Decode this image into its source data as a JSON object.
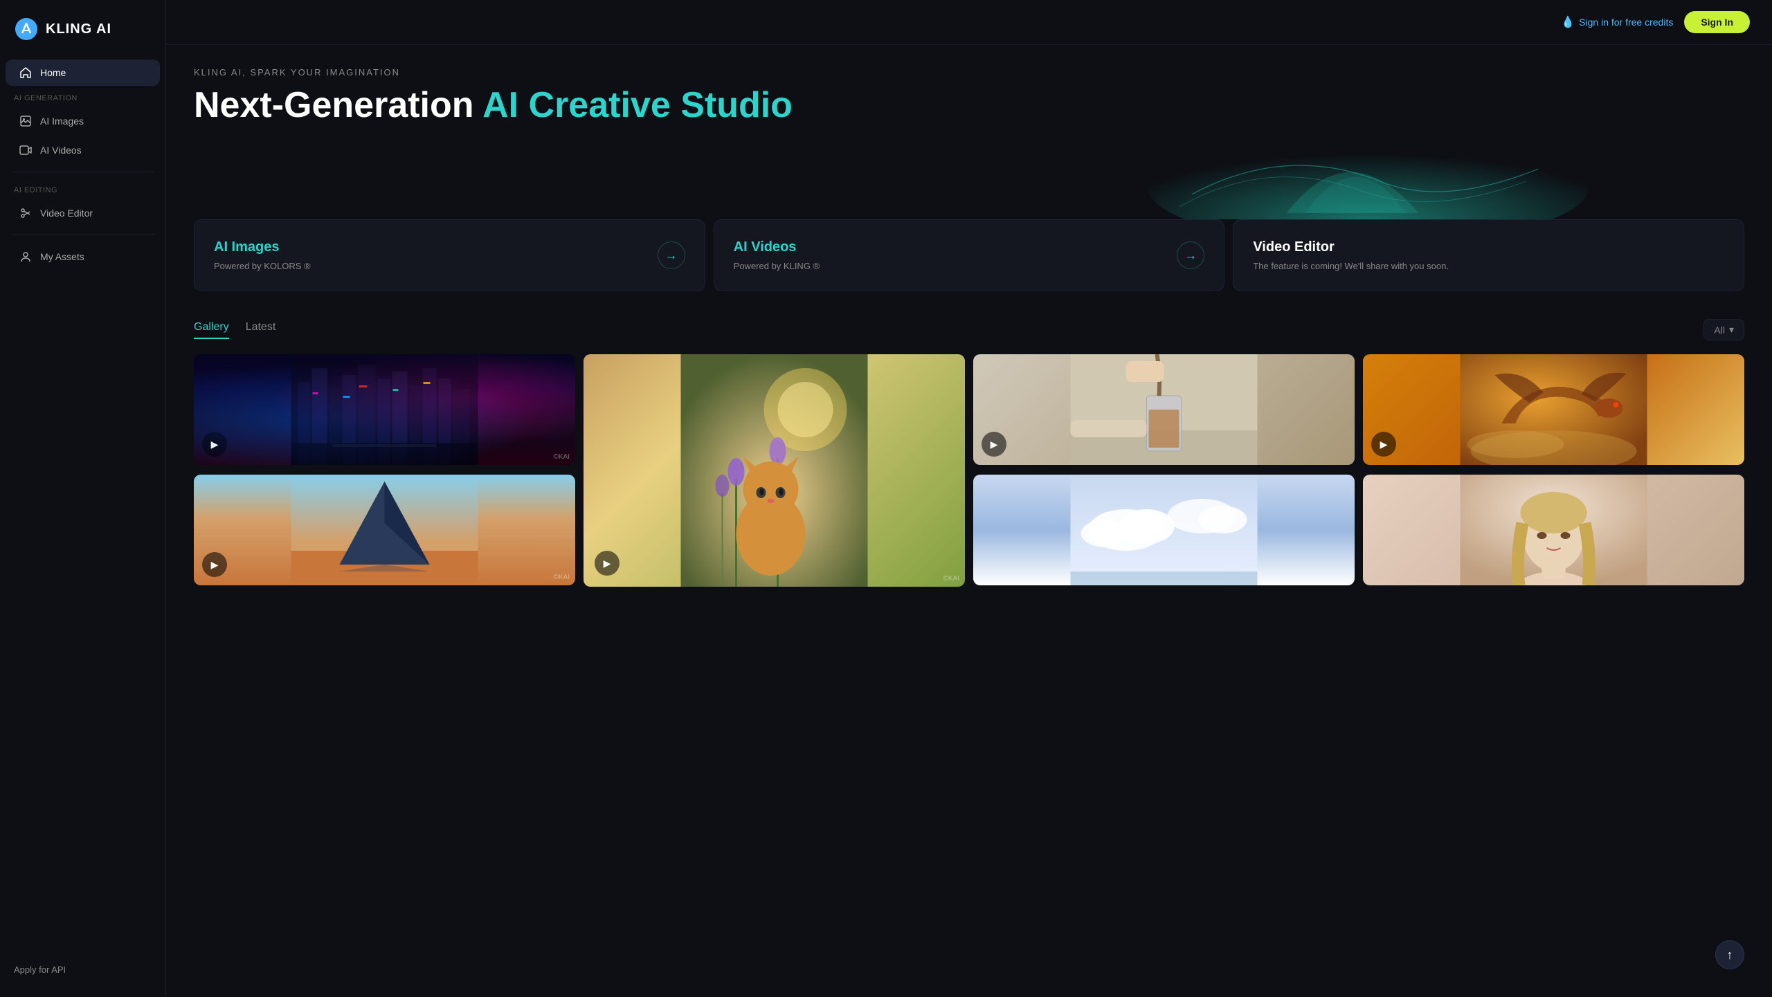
{
  "app": {
    "name": "KLING AI"
  },
  "header": {
    "sign_in_free_label": "Sign in for free credits",
    "sign_in_button": "Sign In"
  },
  "sidebar": {
    "logo_text": "KLING AI",
    "nav_items": [
      {
        "id": "home",
        "label": "Home",
        "icon": "home-icon",
        "active": true,
        "section": null
      },
      {
        "id": "ai-images",
        "label": "AI Images",
        "icon": "image-icon",
        "active": false,
        "section": "AI Generation"
      },
      {
        "id": "ai-videos",
        "label": "AI Videos",
        "icon": "video-icon",
        "active": false,
        "section": null
      },
      {
        "id": "video-editor",
        "label": "Video Editor",
        "icon": "scissors-icon",
        "active": false,
        "section": "AI Editing"
      },
      {
        "id": "my-assets",
        "label": "My Assets",
        "icon": "user-icon",
        "active": false,
        "section": null
      }
    ],
    "apply_api_label": "Apply for API"
  },
  "hero": {
    "subtitle": "KLING AI, SPARK YOUR IMAGINATION",
    "title_black": "Next-Generation",
    "title_cyan": "AI Creative Studio"
  },
  "feature_cards": [
    {
      "id": "ai-images-card",
      "title": "AI Images",
      "title_color": "cyan",
      "subtitle": "Powered by KOLORS ®",
      "has_arrow": true
    },
    {
      "id": "ai-videos-card",
      "title": "AI Videos",
      "title_color": "cyan",
      "subtitle": "Powered by KLING ®",
      "has_arrow": true
    },
    {
      "id": "video-editor-card",
      "title": "Video Editor",
      "title_color": "white",
      "subtitle": "The feature is coming! We'll share with you soon.",
      "has_arrow": false
    }
  ],
  "gallery": {
    "tabs": [
      "Gallery",
      "Latest"
    ],
    "active_tab": "Gallery",
    "filter_label": "All",
    "items": [
      {
        "id": "city-night",
        "bg": "city",
        "has_play": true,
        "tall": false,
        "watermark": "©KAI"
      },
      {
        "id": "cat-flowers",
        "bg": "cat",
        "has_play": true,
        "tall": true,
        "watermark": "©KAI"
      },
      {
        "id": "coffee-pour",
        "bg": "coffee",
        "has_play": true,
        "tall": false,
        "watermark": ""
      },
      {
        "id": "dragon",
        "bg": "dragon",
        "has_play": true,
        "tall": false,
        "watermark": ""
      },
      {
        "id": "pyramid",
        "bg": "pyramid",
        "has_play": true,
        "tall": false,
        "watermark": "©KAI"
      },
      {
        "id": "sky-clouds",
        "bg": "sky",
        "has_play": false,
        "tall": false,
        "watermark": ""
      },
      {
        "id": "portrait",
        "bg": "portrait",
        "has_play": false,
        "tall": false,
        "watermark": ""
      }
    ]
  },
  "scroll_top_icon": "↑"
}
